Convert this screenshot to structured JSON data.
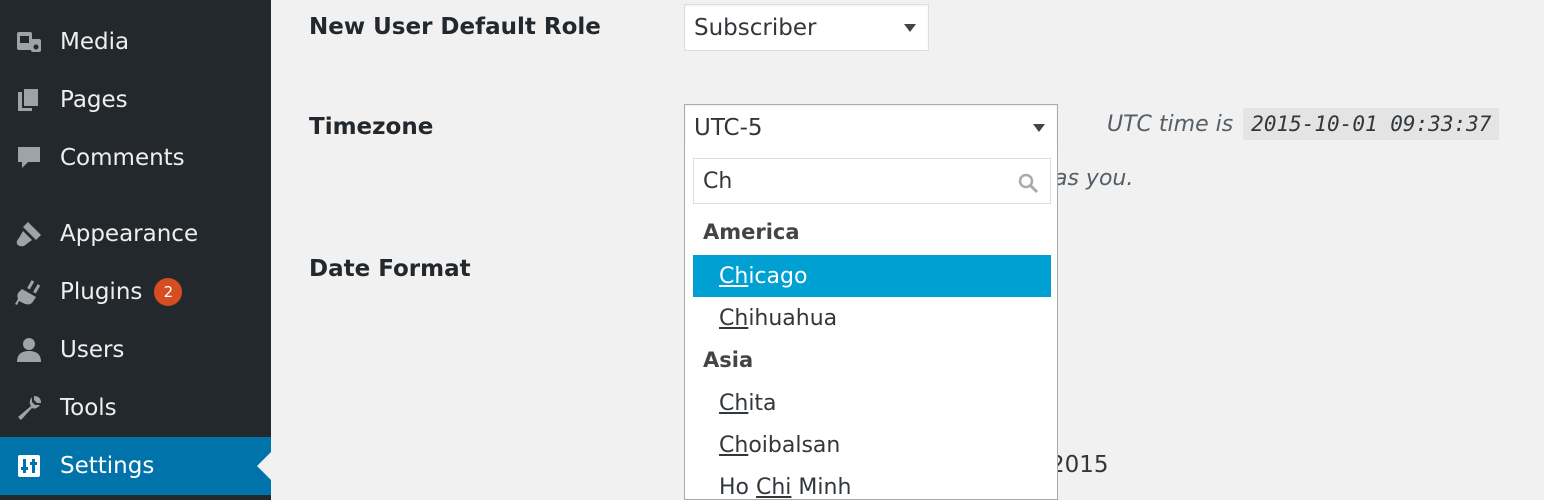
{
  "sidebar": {
    "items": [
      {
        "label": "Media",
        "icon": "media-icon"
      },
      {
        "label": "Pages",
        "icon": "pages-icon"
      },
      {
        "label": "Comments",
        "icon": "comments-icon"
      },
      {
        "label": "Appearance",
        "icon": "appearance-icon"
      },
      {
        "label": "Plugins",
        "icon": "plugins-icon",
        "badge": "2"
      },
      {
        "label": "Users",
        "icon": "users-icon"
      },
      {
        "label": "Tools",
        "icon": "tools-icon"
      },
      {
        "label": "Settings",
        "icon": "settings-icon",
        "active": true
      }
    ],
    "colors": {
      "background": "#23282d",
      "active": "#0073aa",
      "badge": "#d54e21"
    }
  },
  "settings": {
    "default_role": {
      "label": "New User Default Role",
      "value": "Subscriber"
    },
    "timezone": {
      "label": "Timezone",
      "value": "UTC-5",
      "utc_prefix": "UTC time is",
      "utc_time": "2015-10-01 09:33:37",
      "description_tail": "as you."
    },
    "date_format": {
      "label": "Date Format",
      "visible_tail": "2015"
    }
  },
  "timezone_dropdown": {
    "search_value": "Ch",
    "search_icon": "search-icon",
    "highlight_color": "#00a0d2",
    "groups": [
      {
        "label": "America",
        "options": [
          {
            "match": "Ch",
            "rest": "icago",
            "highlighted": true
          },
          {
            "match": "Ch",
            "rest": "ihuahua"
          }
        ]
      },
      {
        "label": "Asia",
        "options": [
          {
            "match": "Ch",
            "rest": "ita"
          },
          {
            "match": "Ch",
            "rest": "oibalsan"
          },
          {
            "pre": "Ho ",
            "match": "Chi",
            "rest": " Minh"
          }
        ]
      }
    ]
  }
}
